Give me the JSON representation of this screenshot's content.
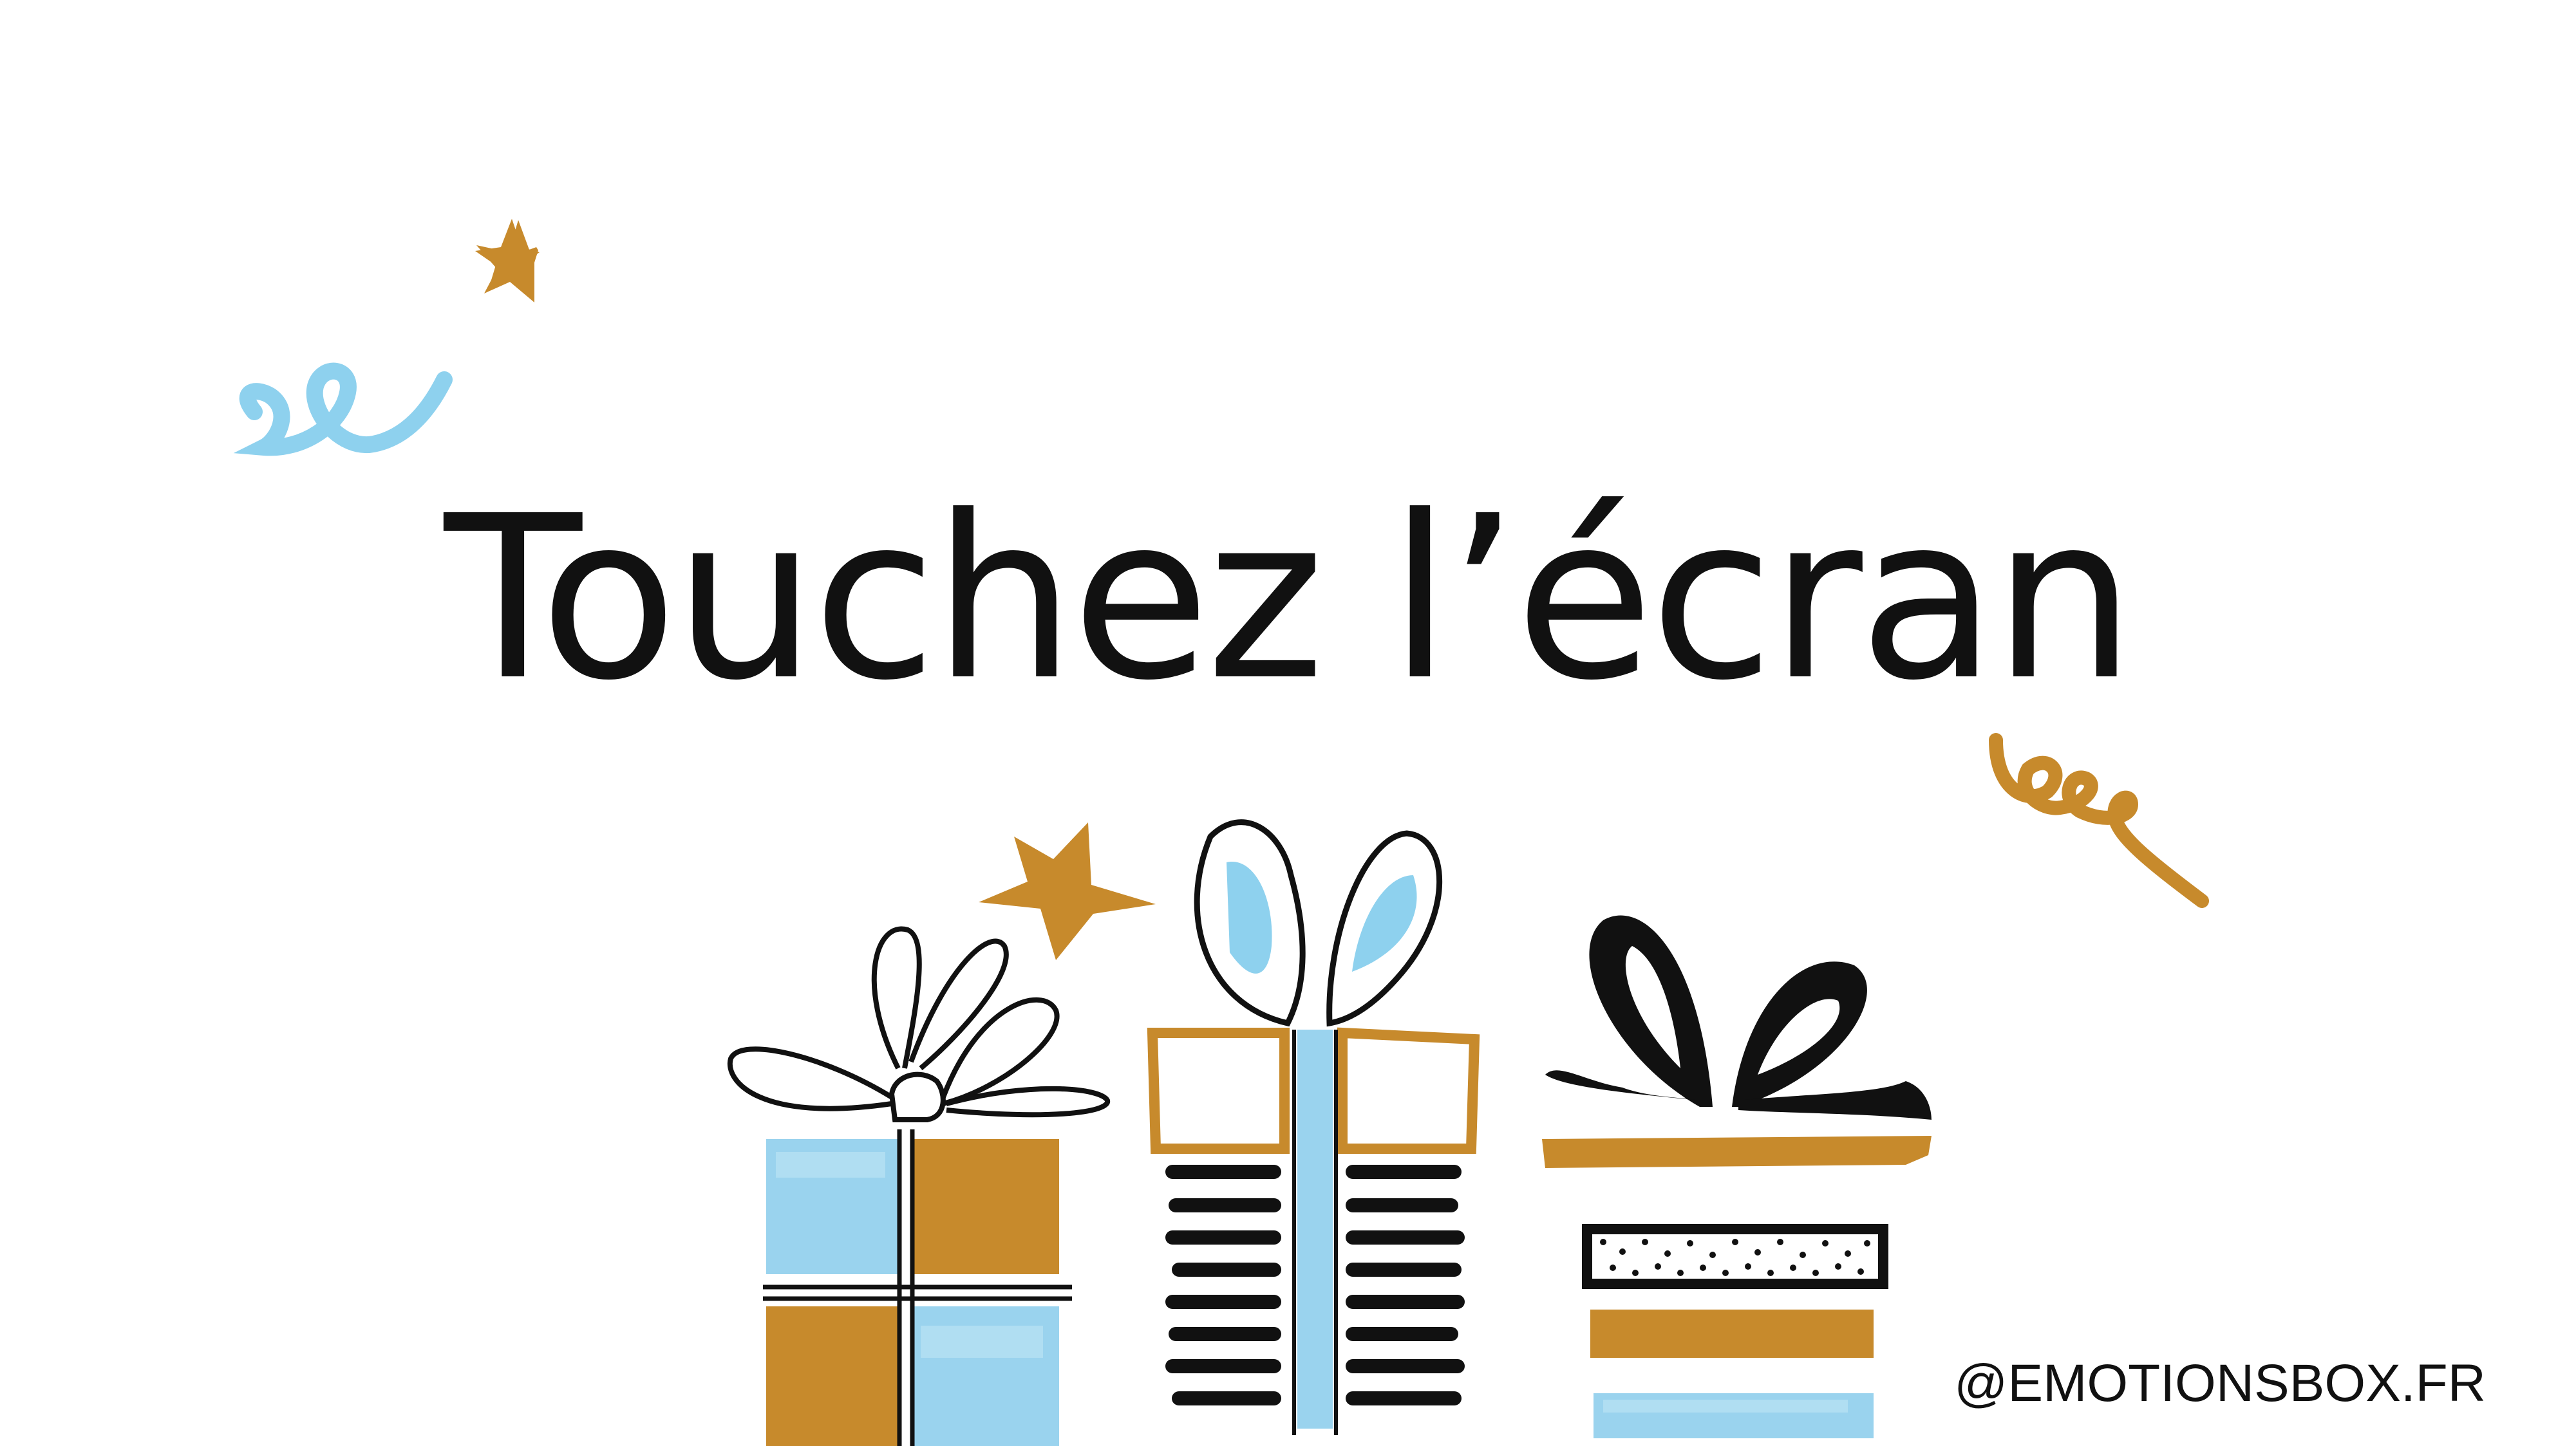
{
  "screen": {
    "headline": "Touchez l’écran",
    "social_handle": "@EMOTIONSBOX.FR"
  },
  "colors": {
    "background": "#ffffff",
    "text": "#111111",
    "gold": "#C78A2C",
    "sky_blue": "#8ED1EE",
    "ink": "#111111"
  },
  "icons": [
    "star-icon",
    "ribbon-swirl-icon",
    "gift-box-icon"
  ]
}
